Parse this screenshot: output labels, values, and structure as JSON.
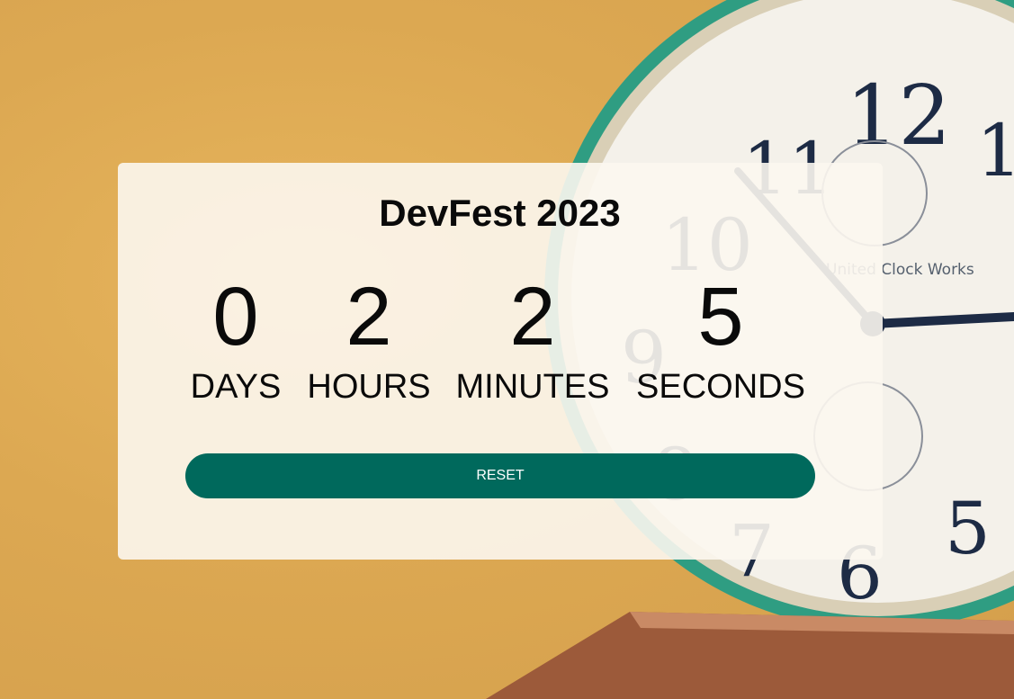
{
  "event": {
    "title": "DevFest 2023"
  },
  "countdown": [
    {
      "value": "0",
      "label": "DAYS"
    },
    {
      "value": "2",
      "label": "HOURS"
    },
    {
      "value": "2",
      "label": "MINUTES"
    },
    {
      "value": "5",
      "label": "SECONDS"
    }
  ],
  "actions": {
    "reset_label": "RESET"
  },
  "background": {
    "clock_face_text": "United Clock Works"
  },
  "colors": {
    "accent": "#00695c",
    "background": "#dca852",
    "card": "#fcf7f0"
  }
}
